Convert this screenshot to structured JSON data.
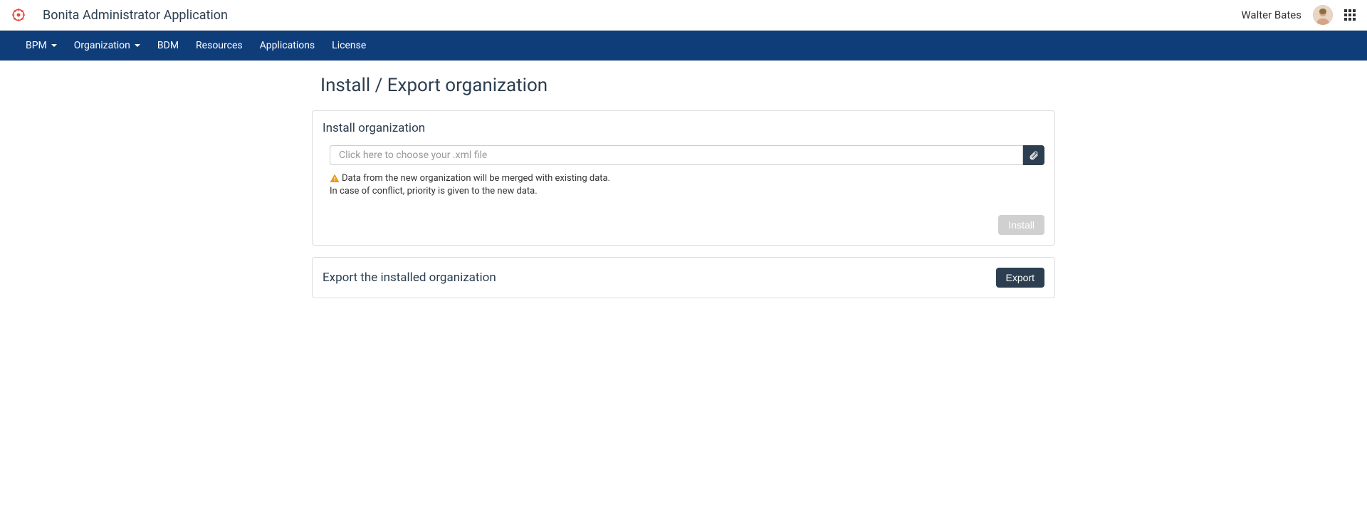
{
  "header": {
    "app_title": "Bonita Administrator Application",
    "username": "Walter Bates"
  },
  "nav": {
    "items": [
      {
        "label": "BPM",
        "has_dropdown": true
      },
      {
        "label": "Organization",
        "has_dropdown": true
      },
      {
        "label": "BDM",
        "has_dropdown": false
      },
      {
        "label": "Resources",
        "has_dropdown": false
      },
      {
        "label": "Applications",
        "has_dropdown": false
      },
      {
        "label": "License",
        "has_dropdown": false
      }
    ]
  },
  "page": {
    "title": "Install / Export organization"
  },
  "install_panel": {
    "title": "Install organization",
    "file_placeholder": "Click here to choose your .xml file",
    "warning_line1": "Data from the new organization will be merged with existing data.",
    "warning_line2": "In case of conflict, priority is given to the new data.",
    "install_button": "Install"
  },
  "export_panel": {
    "title": "Export the installed organization",
    "export_button": "Export"
  }
}
